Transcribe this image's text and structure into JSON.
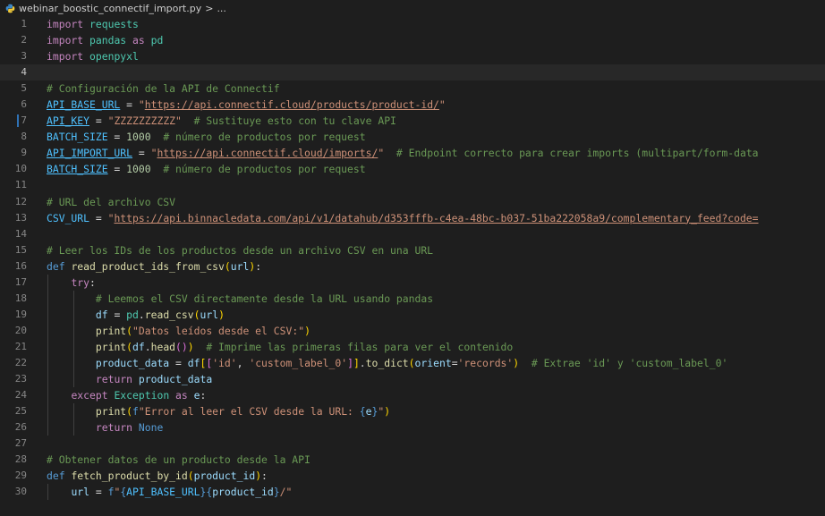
{
  "breadcrumb": {
    "file": "webinar_boostic_connectif_import.py",
    "sep": ">",
    "more": "..."
  },
  "lines": [
    {
      "n": "1",
      "parts": [
        [
          "kw",
          "import"
        ],
        [
          "",
          ""
        ],
        [
          "",
          " "
        ],
        [
          "mod",
          "requests"
        ]
      ]
    },
    {
      "n": "2",
      "parts": [
        [
          "kw",
          "import"
        ],
        [
          "",
          " "
        ],
        [
          "mod",
          "pandas"
        ],
        [
          "",
          " "
        ],
        [
          "kw",
          "as"
        ],
        [
          "",
          " "
        ],
        [
          "mod",
          "pd"
        ]
      ]
    },
    {
      "n": "3",
      "parts": [
        [
          "kw",
          "import"
        ],
        [
          "",
          " "
        ],
        [
          "mod",
          "openpyxl"
        ]
      ]
    },
    {
      "n": "4",
      "active": true,
      "parts": []
    },
    {
      "n": "5",
      "parts": [
        [
          "cm",
          "# Configuración de la API de Connectif"
        ]
      ]
    },
    {
      "n": "6",
      "parts": [
        [
          "var u",
          "API_BASE_URL"
        ],
        [
          "",
          " = "
        ],
        [
          "str",
          "\""
        ],
        [
          "str u",
          "https://api.connectif.cloud/products/product-id/"
        ],
        [
          "str",
          "\""
        ]
      ]
    },
    {
      "n": "7",
      "marker": true,
      "parts": [
        [
          "var u",
          "API_KEY"
        ],
        [
          "",
          " = "
        ],
        [
          "str",
          "\"ZZZZZZZZZZ\""
        ],
        [
          "",
          "  "
        ],
        [
          "cm",
          "# Sustituye esto con tu clave API"
        ]
      ]
    },
    {
      "n": "8",
      "parts": [
        [
          "var",
          "BATCH_SIZE"
        ],
        [
          "",
          " = "
        ],
        [
          "num",
          "1000"
        ],
        [
          "",
          "  "
        ],
        [
          "cm",
          "# número de productos por request"
        ]
      ]
    },
    {
      "n": "9",
      "parts": [
        [
          "var u",
          "API_IMPORT_URL"
        ],
        [
          "",
          " = "
        ],
        [
          "str",
          "\""
        ],
        [
          "str u",
          "https://api.connectif.cloud/imports/"
        ],
        [
          "str",
          "\""
        ],
        [
          "",
          "  "
        ],
        [
          "cm",
          "# Endpoint correcto para crear imports (multipart/form-data"
        ]
      ]
    },
    {
      "n": "10",
      "parts": [
        [
          "var u",
          "BATCH_SIZE"
        ],
        [
          "",
          " = "
        ],
        [
          "num",
          "1000"
        ],
        [
          "",
          "  "
        ],
        [
          "cm",
          "# número de productos por request"
        ]
      ]
    },
    {
      "n": "11",
      "parts": []
    },
    {
      "n": "12",
      "parts": [
        [
          "cm",
          "# URL del archivo CSV"
        ]
      ]
    },
    {
      "n": "13",
      "parts": [
        [
          "var",
          "CSV_URL"
        ],
        [
          "",
          " = "
        ],
        [
          "str",
          "\""
        ],
        [
          "str u",
          "https://api.binnacledata.com/api/v1/datahub/d353fffb-c4ea-48bc-b037-51ba222058a9/complementary_feed?code="
        ]
      ]
    },
    {
      "n": "14",
      "parts": []
    },
    {
      "n": "15",
      "parts": [
        [
          "cm",
          "# Leer los IDs de los productos desde un archivo CSV en una URL"
        ]
      ]
    },
    {
      "n": "16",
      "parts": [
        [
          "def",
          "def"
        ],
        [
          "",
          " "
        ],
        [
          "fn",
          "read_product_ids_from_csv"
        ],
        [
          "brk",
          "("
        ],
        [
          "id",
          "url"
        ],
        [
          "brk",
          ")"
        ],
        [
          "",
          ":"
        ]
      ]
    },
    {
      "n": "17",
      "parts": [
        [
          "",
          "    "
        ],
        [
          "kw",
          "try"
        ],
        [
          "",
          ":"
        ]
      ]
    },
    {
      "n": "18",
      "parts": [
        [
          "",
          "        "
        ],
        [
          "cm",
          "# Leemos el CSV directamente desde la URL usando pandas"
        ]
      ]
    },
    {
      "n": "19",
      "parts": [
        [
          "",
          "        "
        ],
        [
          "id",
          "df"
        ],
        [
          "",
          " = "
        ],
        [
          "mod",
          "pd"
        ],
        [
          "",
          "."
        ],
        [
          "fn",
          "read_csv"
        ],
        [
          "brk",
          "("
        ],
        [
          "id",
          "url"
        ],
        [
          "brk",
          ")"
        ]
      ]
    },
    {
      "n": "20",
      "parts": [
        [
          "",
          "        "
        ],
        [
          "fn",
          "print"
        ],
        [
          "brk",
          "("
        ],
        [
          "str",
          "\"Datos leídos desde el CSV:\""
        ],
        [
          "brk",
          ")"
        ]
      ]
    },
    {
      "n": "21",
      "parts": [
        [
          "",
          "        "
        ],
        [
          "fn",
          "print"
        ],
        [
          "brk",
          "("
        ],
        [
          "id",
          "df"
        ],
        [
          "",
          "."
        ],
        [
          "fn",
          "head"
        ],
        [
          "brk2",
          "()"
        ],
        [
          "brk",
          ")"
        ],
        [
          "",
          "  "
        ],
        [
          "cm",
          "# Imprime las primeras filas para ver el contenido"
        ]
      ]
    },
    {
      "n": "22",
      "parts": [
        [
          "",
          "        "
        ],
        [
          "id",
          "product_data"
        ],
        [
          "",
          " = "
        ],
        [
          "id",
          "df"
        ],
        [
          "brk",
          "["
        ],
        [
          "brk2",
          "["
        ],
        [
          "str",
          "'id'"
        ],
        [
          "",
          ", "
        ],
        [
          "str",
          "'custom_label_0'"
        ],
        [
          "brk2",
          "]"
        ],
        [
          "brk",
          "]"
        ],
        [
          "",
          "."
        ],
        [
          "fn",
          "to_dict"
        ],
        [
          "brk",
          "("
        ],
        [
          "id",
          "orient"
        ],
        [
          "",
          "="
        ],
        [
          "str",
          "'records'"
        ],
        [
          "brk",
          ")"
        ],
        [
          "",
          "  "
        ],
        [
          "cm",
          "# Extrae 'id' y 'custom_label_0'"
        ]
      ]
    },
    {
      "n": "23",
      "parts": [
        [
          "",
          "        "
        ],
        [
          "kw",
          "return"
        ],
        [
          "",
          " "
        ],
        [
          "id",
          "product_data"
        ]
      ]
    },
    {
      "n": "24",
      "parts": [
        [
          "",
          "    "
        ],
        [
          "kw",
          "except"
        ],
        [
          "",
          " "
        ],
        [
          "cls",
          "Exception"
        ],
        [
          "",
          " "
        ],
        [
          "kw",
          "as"
        ],
        [
          "",
          " "
        ],
        [
          "id",
          "e"
        ],
        [
          "",
          ":"
        ]
      ]
    },
    {
      "n": "25",
      "parts": [
        [
          "",
          "        "
        ],
        [
          "fn",
          "print"
        ],
        [
          "brk",
          "("
        ],
        [
          "def",
          "f"
        ],
        [
          "str",
          "\"Error al leer el CSV desde la URL: "
        ],
        [
          "def",
          "{"
        ],
        [
          "id",
          "e"
        ],
        [
          "def",
          "}"
        ],
        [
          "str",
          "\""
        ],
        [
          "brk",
          ")"
        ]
      ]
    },
    {
      "n": "26",
      "parts": [
        [
          "",
          "        "
        ],
        [
          "kw",
          "return"
        ],
        [
          "",
          " "
        ],
        [
          "def",
          "None"
        ]
      ]
    },
    {
      "n": "27",
      "parts": []
    },
    {
      "n": "28",
      "parts": [
        [
          "cm",
          "# Obtener datos de un producto desde la API"
        ]
      ]
    },
    {
      "n": "29",
      "parts": [
        [
          "def",
          "def"
        ],
        [
          "",
          " "
        ],
        [
          "fn",
          "fetch_product_by_id"
        ],
        [
          "brk",
          "("
        ],
        [
          "id",
          "product_id"
        ],
        [
          "brk",
          ")"
        ],
        [
          "",
          ":"
        ]
      ]
    },
    {
      "n": "30",
      "parts": [
        [
          "",
          "    "
        ],
        [
          "id",
          "url"
        ],
        [
          "",
          " = "
        ],
        [
          "def",
          "f"
        ],
        [
          "str",
          "\""
        ],
        [
          "def",
          "{"
        ],
        [
          "var",
          "API_BASE_URL"
        ],
        [
          "def",
          "}"
        ],
        [
          "def",
          "{"
        ],
        [
          "id",
          "product_id"
        ],
        [
          "def",
          "}"
        ],
        [
          "str",
          "/\""
        ]
      ]
    }
  ]
}
